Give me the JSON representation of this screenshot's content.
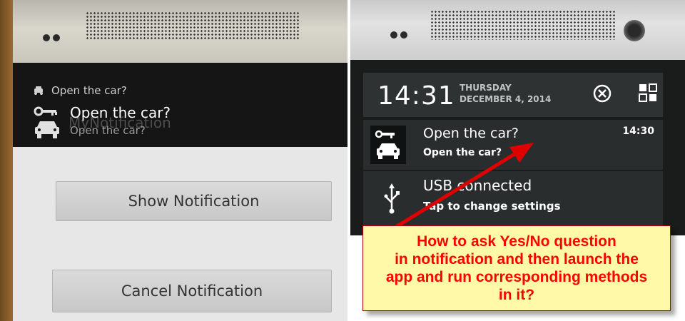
{
  "left_photo": {
    "small_notification": "Open the car?",
    "notification_title": "Open the car?",
    "notification_text": "Open the car?",
    "ghost_label": "MyNotification",
    "show_button": "Show Notification",
    "cancel_button": "Cancel Notification"
  },
  "right_photo": {
    "clock": "14:31",
    "day": "THURSDAY",
    "date": "DECEMBER 4, 2014",
    "notification": {
      "title": "Open the car?",
      "text": "Open the car?",
      "time": "14:30"
    },
    "usb_notification": {
      "title": "USB connected",
      "text": "Tap to change settings"
    }
  },
  "callout": {
    "lines": [
      "How to ask Yes/No question",
      "in notification and then launch the",
      "app and run corresponding methods",
      "in it?"
    ]
  },
  "colors": {
    "callout_background": "#fff9a8",
    "callout_text": "#ff0000",
    "arrow": "#e00000"
  },
  "icons": [
    "car-key-icon",
    "status-car-icon",
    "clear-all-icon",
    "quick-settings-icon",
    "usb-icon"
  ]
}
